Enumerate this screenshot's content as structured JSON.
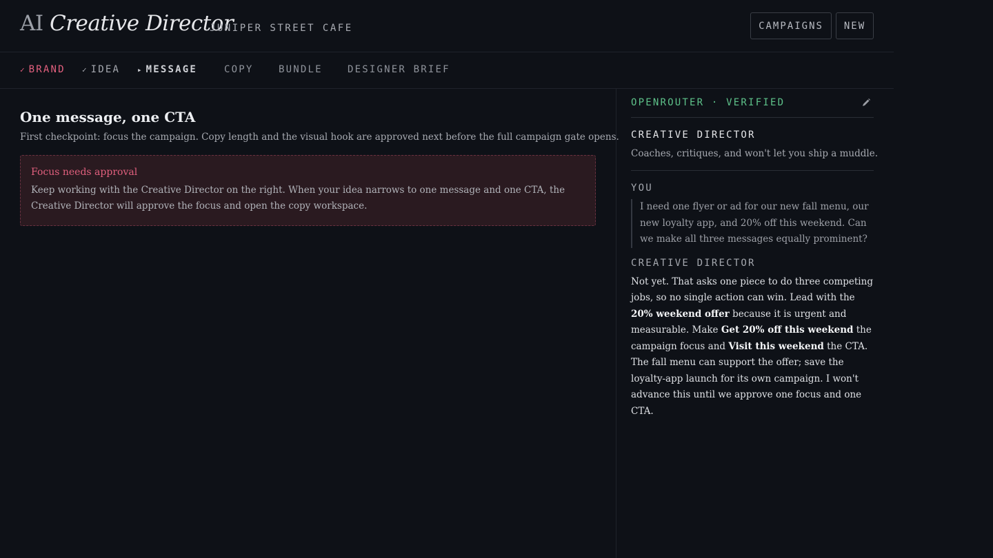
{
  "header": {
    "logo_prefix": "AI",
    "logo_name": "Creative Director",
    "brand": "JUNIPER STREET CAFE",
    "campaigns_label": "CAMPAIGNS",
    "new_label": "NEW"
  },
  "steps": [
    {
      "mark": "✓",
      "label": "BRAND",
      "state": "done"
    },
    {
      "mark": "✓",
      "label": "IDEA",
      "state": "done"
    },
    {
      "mark": "▸",
      "label": "MESSAGE",
      "state": "current"
    },
    {
      "mark": "",
      "label": "COPY",
      "state": "pending"
    },
    {
      "mark": "",
      "label": "BUNDLE",
      "state": "pending"
    },
    {
      "mark": "",
      "label": "DESIGNER BRIEF",
      "state": "pending"
    }
  ],
  "main": {
    "title": "One message, one CTA",
    "subtitle": "First checkpoint: focus the campaign. Copy length and the visual hook are approved next before the full campaign gate opens.",
    "approval_title": "Focus needs approval",
    "approval_body": "Keep working with the Creative Director on the right. When your idea narrows to one message and one CTA, the Creative Director will approve the focus and open the copy workspace."
  },
  "side": {
    "provider": "OPENROUTER · VERIFIED",
    "edit_icon": "pencil-icon",
    "persona_title": "CREATIVE DIRECTOR",
    "persona_desc": "Coaches, critiques, and won't let you ship a muddle.",
    "you_label": "YOU",
    "you_message": "I need one flyer or ad for our new fall menu, our new loyalty app, and 20% off this weekend. Can we make all three messages equally prominent?",
    "cd_label": "CREATIVE DIRECTOR",
    "cd_message": {
      "p1": "Not yet. That asks one piece to do three competing jobs, so no single action can win. Lead with the ",
      "b1": "20% weekend offer",
      "p2": " because it is urgent and measurable. Make ",
      "b2": "Get 20% off this weekend",
      "p3": " the campaign focus and ",
      "b3": "Visit this weekend",
      "p4": " the CTA. The fall menu can support the offer; save the loyalty-app launch for its own campaign. I won't advance this until we approve one focus and one CTA."
    }
  },
  "colors": {
    "background": "#0e1117",
    "accent_pink": "#e2607e",
    "verified_green": "#5ec28a"
  }
}
